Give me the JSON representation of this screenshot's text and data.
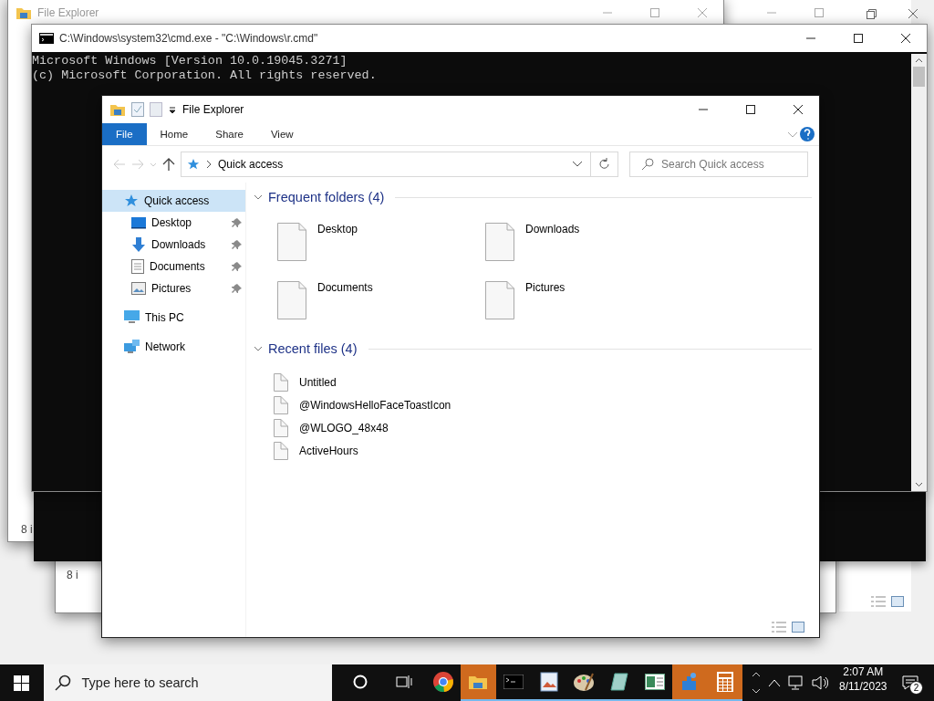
{
  "background_windows": [
    {
      "title": "File Explorer",
      "status": "8 i",
      "kind": "explorer"
    },
    {
      "status": "8 i",
      "kind": "explorer_low"
    }
  ],
  "console": {
    "title": "C:\\Windows\\system32\\cmd.exe - \"C:\\Windows\\r.cmd\"",
    "lines": [
      "Microsoft Windows [Version 10.0.19045.3271]",
      "(c) Microsoft Corporation. All rights reserved."
    ]
  },
  "explorer": {
    "title": "File Explorer",
    "ribbon_tabs": [
      {
        "label": "File",
        "selected": true
      },
      {
        "label": "Home",
        "selected": false
      },
      {
        "label": "Share",
        "selected": false
      },
      {
        "label": "View",
        "selected": false
      }
    ],
    "address": "Quick access",
    "search": {
      "placeholder": "Search Quick access"
    },
    "sidebar": {
      "items": [
        {
          "label": "Quick access",
          "kind": "star",
          "selected": true,
          "children": [
            {
              "label": "Desktop",
              "kind": "desktop",
              "pinned": true,
              "selected": false
            },
            {
              "label": "Downloads",
              "kind": "download",
              "pinned": true,
              "selected": false
            },
            {
              "label": "Documents",
              "kind": "document",
              "pinned": true,
              "selected": false
            },
            {
              "label": "Pictures",
              "kind": "picture",
              "pinned": true,
              "selected": false
            }
          ]
        },
        {
          "label": "This PC",
          "kind": "pc",
          "selected": false
        },
        {
          "label": "Network",
          "kind": "network",
          "selected": false
        }
      ]
    },
    "sections": [
      {
        "title": "Frequent folders (4)",
        "expanded": true,
        "kind": "tiles",
        "items": [
          "Desktop",
          "Downloads",
          "Documents",
          "Pictures"
        ]
      },
      {
        "title": "Recent files (4)",
        "expanded": true,
        "kind": "list",
        "items": [
          "Untitled",
          "@WindowsHelloFaceToastIcon",
          "@WLOGO_48x48",
          "ActiveHours"
        ]
      }
    ]
  },
  "taskbar": {
    "search": {
      "placeholder": "Type here to search"
    },
    "apps": [
      {
        "kind": "cortana",
        "active": false,
        "running": false
      },
      {
        "kind": "taskview",
        "active": false,
        "running": false
      },
      {
        "kind": "chrome",
        "active": false,
        "running": false
      },
      {
        "kind": "folder",
        "active": true,
        "running": true
      },
      {
        "kind": "console",
        "active": false,
        "running": true
      },
      {
        "kind": "viewer",
        "active": false,
        "running": true
      },
      {
        "kind": "paint",
        "active": false,
        "running": true
      },
      {
        "kind": "tablet",
        "active": false,
        "running": true
      },
      {
        "kind": "form",
        "active": false,
        "running": true
      },
      {
        "kind": "puzzle",
        "active": true,
        "running": true
      },
      {
        "kind": "calculator",
        "active": true,
        "running": true
      }
    ],
    "time": "2:07 AM",
    "date": "8/11/2023",
    "notifications": "2"
  }
}
